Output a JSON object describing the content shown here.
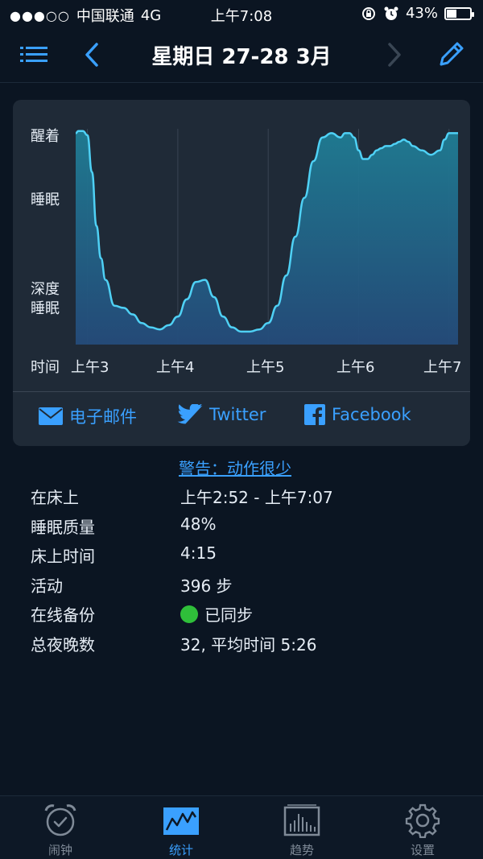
{
  "status_bar": {
    "carrier": "中国联通",
    "network": "4G",
    "time": "上午7:08",
    "battery": "43%",
    "battery_level": 0.43
  },
  "nav": {
    "title": "星期日 27-28 3月",
    "icons": [
      "list-icon",
      "chevron-left-icon",
      "chevron-right-icon",
      "pencil-icon"
    ]
  },
  "chart_data": {
    "type": "area",
    "y_levels": [
      "醒着",
      "睡眠",
      "深度睡眠"
    ],
    "x_axis_label": "时间",
    "x_ticks": [
      "上午3",
      "上午4",
      "上午5",
      "上午6",
      "上午7"
    ],
    "y_ticks": [
      "醒着",
      "睡眠",
      "深度\n睡眠"
    ],
    "ylim": [
      0,
      100
    ],
    "x": [
      2.87,
      2.9,
      2.95,
      3.0,
      3.05,
      3.1,
      3.15,
      3.2,
      3.3,
      3.4,
      3.5,
      3.6,
      3.7,
      3.8,
      3.9,
      4.0,
      4.1,
      4.2,
      4.3,
      4.4,
      4.5,
      4.6,
      4.7,
      4.8,
      4.9,
      5.0,
      5.1,
      5.2,
      5.3,
      5.4,
      5.5,
      5.6,
      5.7,
      5.8,
      5.85,
      5.9,
      5.95,
      6.0,
      6.05,
      6.1,
      6.15,
      6.2,
      6.25,
      6.3,
      6.35,
      6.4,
      6.45,
      6.5,
      6.55,
      6.6,
      6.7,
      6.8,
      6.9,
      6.95,
      7.0,
      7.05,
      7.1
    ],
    "values": [
      98,
      99,
      99,
      97,
      80,
      55,
      40,
      30,
      18,
      17,
      14,
      10,
      8,
      7,
      9,
      13,
      21,
      29,
      30,
      22,
      13,
      8,
      6,
      6,
      7,
      10,
      18,
      32,
      50,
      68,
      85,
      96,
      98,
      96,
      98,
      98,
      96,
      90,
      86,
      86,
      88,
      90,
      91,
      92,
      92,
      93,
      94,
      95,
      94,
      92,
      90,
      88,
      90,
      95,
      98,
      98,
      98
    ],
    "colors": {
      "line": "#4fd1f5",
      "fill_top": "#1f7d94",
      "fill_bottom": "#244b7a"
    },
    "grid": true
  },
  "share": {
    "email_label": "电子邮件",
    "twitter_label": "Twitter",
    "facebook_label": "Facebook"
  },
  "warning_text": "警告：动作很少",
  "stats": [
    {
      "label": "在床上",
      "value": "上午2:52 - 上午7:07"
    },
    {
      "label": "睡眠质量",
      "value": "48%"
    },
    {
      "label": "床上时间",
      "value": "4:15"
    },
    {
      "label": "活动",
      "value": "396 步"
    },
    {
      "label": "在线备份",
      "value": "已同步",
      "status_color": "#2fbf3a"
    },
    {
      "label": "总夜晚数",
      "value": "32, 平均时间 5:26"
    }
  ],
  "tabs": [
    {
      "label": "闹钟",
      "icon": "alarm-clock-icon",
      "active": false
    },
    {
      "label": "统计",
      "icon": "stats-graph-icon",
      "active": true
    },
    {
      "label": "趋势",
      "icon": "trends-bars-icon",
      "active": false
    },
    {
      "label": "设置",
      "icon": "gear-icon",
      "active": false
    }
  ],
  "colors": {
    "accent": "#3aa0ff",
    "background": "#0b1522",
    "card": "#1f2a37"
  }
}
